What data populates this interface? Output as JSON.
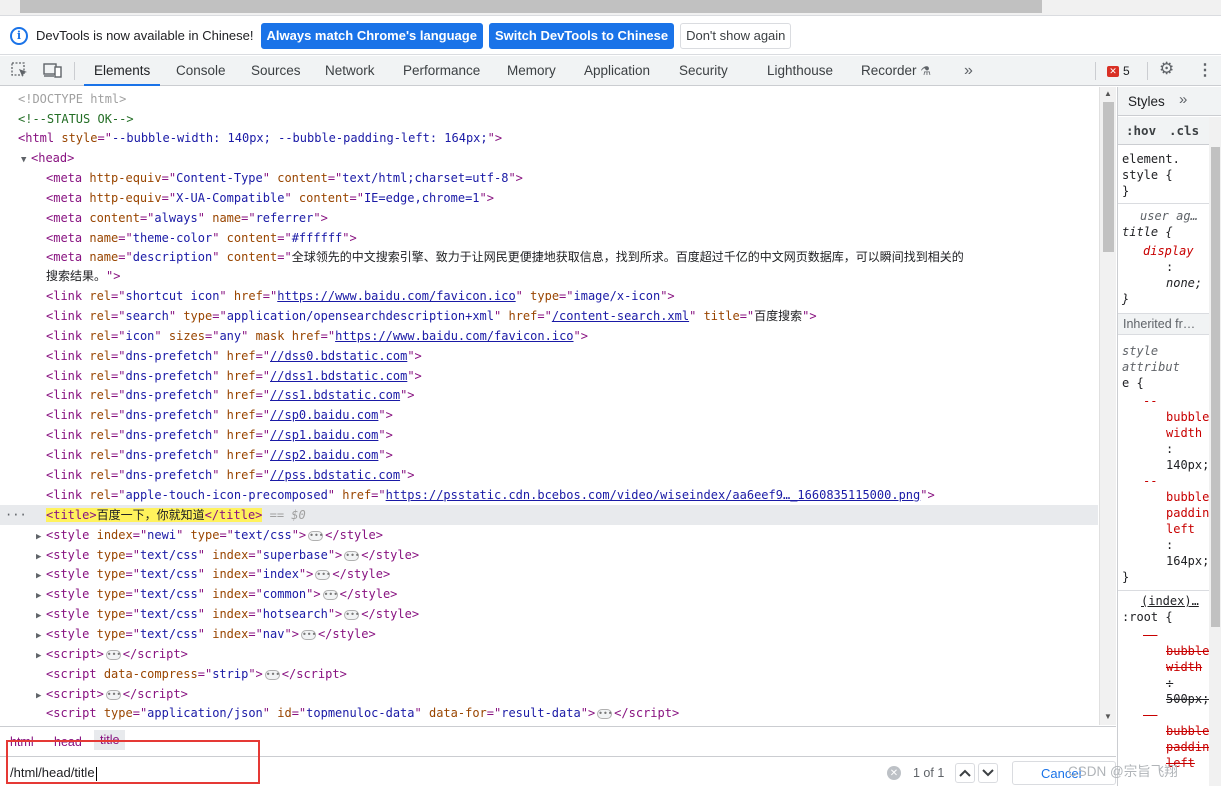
{
  "infobar": {
    "message": "DevTools is now available in Chinese!",
    "match_label": "Always match Chrome's language",
    "switch_label": "Switch DevTools to Chinese",
    "dismiss_label": "Don't show again"
  },
  "tabs": [
    "Elements",
    "Console",
    "Sources",
    "Network",
    "Performance",
    "Memory",
    "Application",
    "Security",
    "Lighthouse",
    "Recorder"
  ],
  "toolbar": {
    "error_count": "5",
    "more_tabs": "»"
  },
  "dom": {
    "doctype": "<!DOCTYPE html>",
    "status_comment": "<!--STATUS OK-->",
    "html_style": "--bubble-width: 140px; --bubble-padding-left: 164px;",
    "meta1": {
      "http_equiv": "Content-Type",
      "content": "text/html;charset=utf-8"
    },
    "meta2": {
      "http_equiv": "X-UA-Compatible",
      "content": "IE=edge,chrome=1"
    },
    "meta3": {
      "content": "always",
      "name": "referrer"
    },
    "meta4": {
      "name": "theme-color",
      "content": "#ffffff"
    },
    "meta5": {
      "name": "description",
      "content_a": "全球领先的中文搜索引擎、致力于让网民更便捷地获取信息，找到所求。百度超过千亿的中文网页数据库，可以瞬间找到相关的",
      "content_b": "搜索结果。"
    },
    "link_shortcut": {
      "rel": "shortcut icon",
      "href": "https://www.baidu.com/favicon.ico",
      "type": "image/x-icon"
    },
    "link_search": {
      "rel": "search",
      "type": "application/opensearchdescription+xml",
      "href": "/content-search.xml",
      "title": "百度搜索"
    },
    "link_icon": {
      "rel": "icon",
      "sizes": "any",
      "href": "https://www.baidu.com/favicon.ico"
    },
    "dns_prefetch": [
      "//dss0.bdstatic.com",
      "//dss1.bdstatic.com",
      "//ss1.bdstatic.com",
      "//sp0.baidu.com",
      "//sp1.baidu.com",
      "//sp2.baidu.com",
      "//pss.bdstatic.com"
    ],
    "apple_touch": {
      "rel": "apple-touch-icon-precomposed",
      "href": "https://psstatic.cdn.bcebos.com/video/wiseindex/aa6eef9…_1660835115000.png"
    },
    "title_text": "百度一下，你就知道",
    "selected_marker": "== $0",
    "styles": [
      {
        "a1": "index",
        "v1": "newi",
        "a2": "type",
        "v2": "text/css"
      },
      {
        "a1": "type",
        "v1": "text/css",
        "a2": "index",
        "v2": "superbase"
      },
      {
        "a1": "type",
        "v1": "text/css",
        "a2": "index",
        "v2": "index"
      },
      {
        "a1": "type",
        "v1": "text/css",
        "a2": "index",
        "v2": "common"
      },
      {
        "a1": "type",
        "v1": "text/css",
        "a2": "index",
        "v2": "hotsearch"
      },
      {
        "a1": "type",
        "v1": "text/css",
        "a2": "index",
        "v2": "nav"
      }
    ],
    "script_compress": "strip",
    "script_json": {
      "type": "application/json",
      "id": "topmenuloc-data",
      "data_for": "result-data"
    }
  },
  "breadcrumbs": [
    "html",
    "head",
    "title"
  ],
  "search": {
    "query": "/html/head/title",
    "result_count": "1 of 1",
    "cancel_label": "Cancel"
  },
  "styles_panel": {
    "tab_label": "Styles",
    "hov": ":hov",
    "cls": ".cls",
    "element_selector_a": "element.",
    "element_selector_b": "style {",
    "ua_label": "user ag…",
    "ua_selector": "title {",
    "ua_prop": "display",
    "ua_value": "none;",
    "inherited_label": "Inherited fr…",
    "style_attr_a": "style",
    "style_attr_b": "attribut",
    "style_attr_c": "e {",
    "prop1_a": "--",
    "prop1_b": "bubble-",
    "prop1_c": "width",
    "val1": "140px;",
    "prop2_b": "bubble-",
    "prop2_c": "paddin",
    "prop2_d": "left",
    "val2": "164px;",
    "index_link": "(index)…",
    "root_selector": ":root {",
    "root_prop1_b": "bubble",
    "root_prop1_c": "width",
    "root_val1": "500px;",
    "root_prop2_b": "bubble",
    "root_prop2_c": "paddin",
    "root_prop2_d": "left"
  },
  "watermark": "CSDN @宗旨飞翔"
}
